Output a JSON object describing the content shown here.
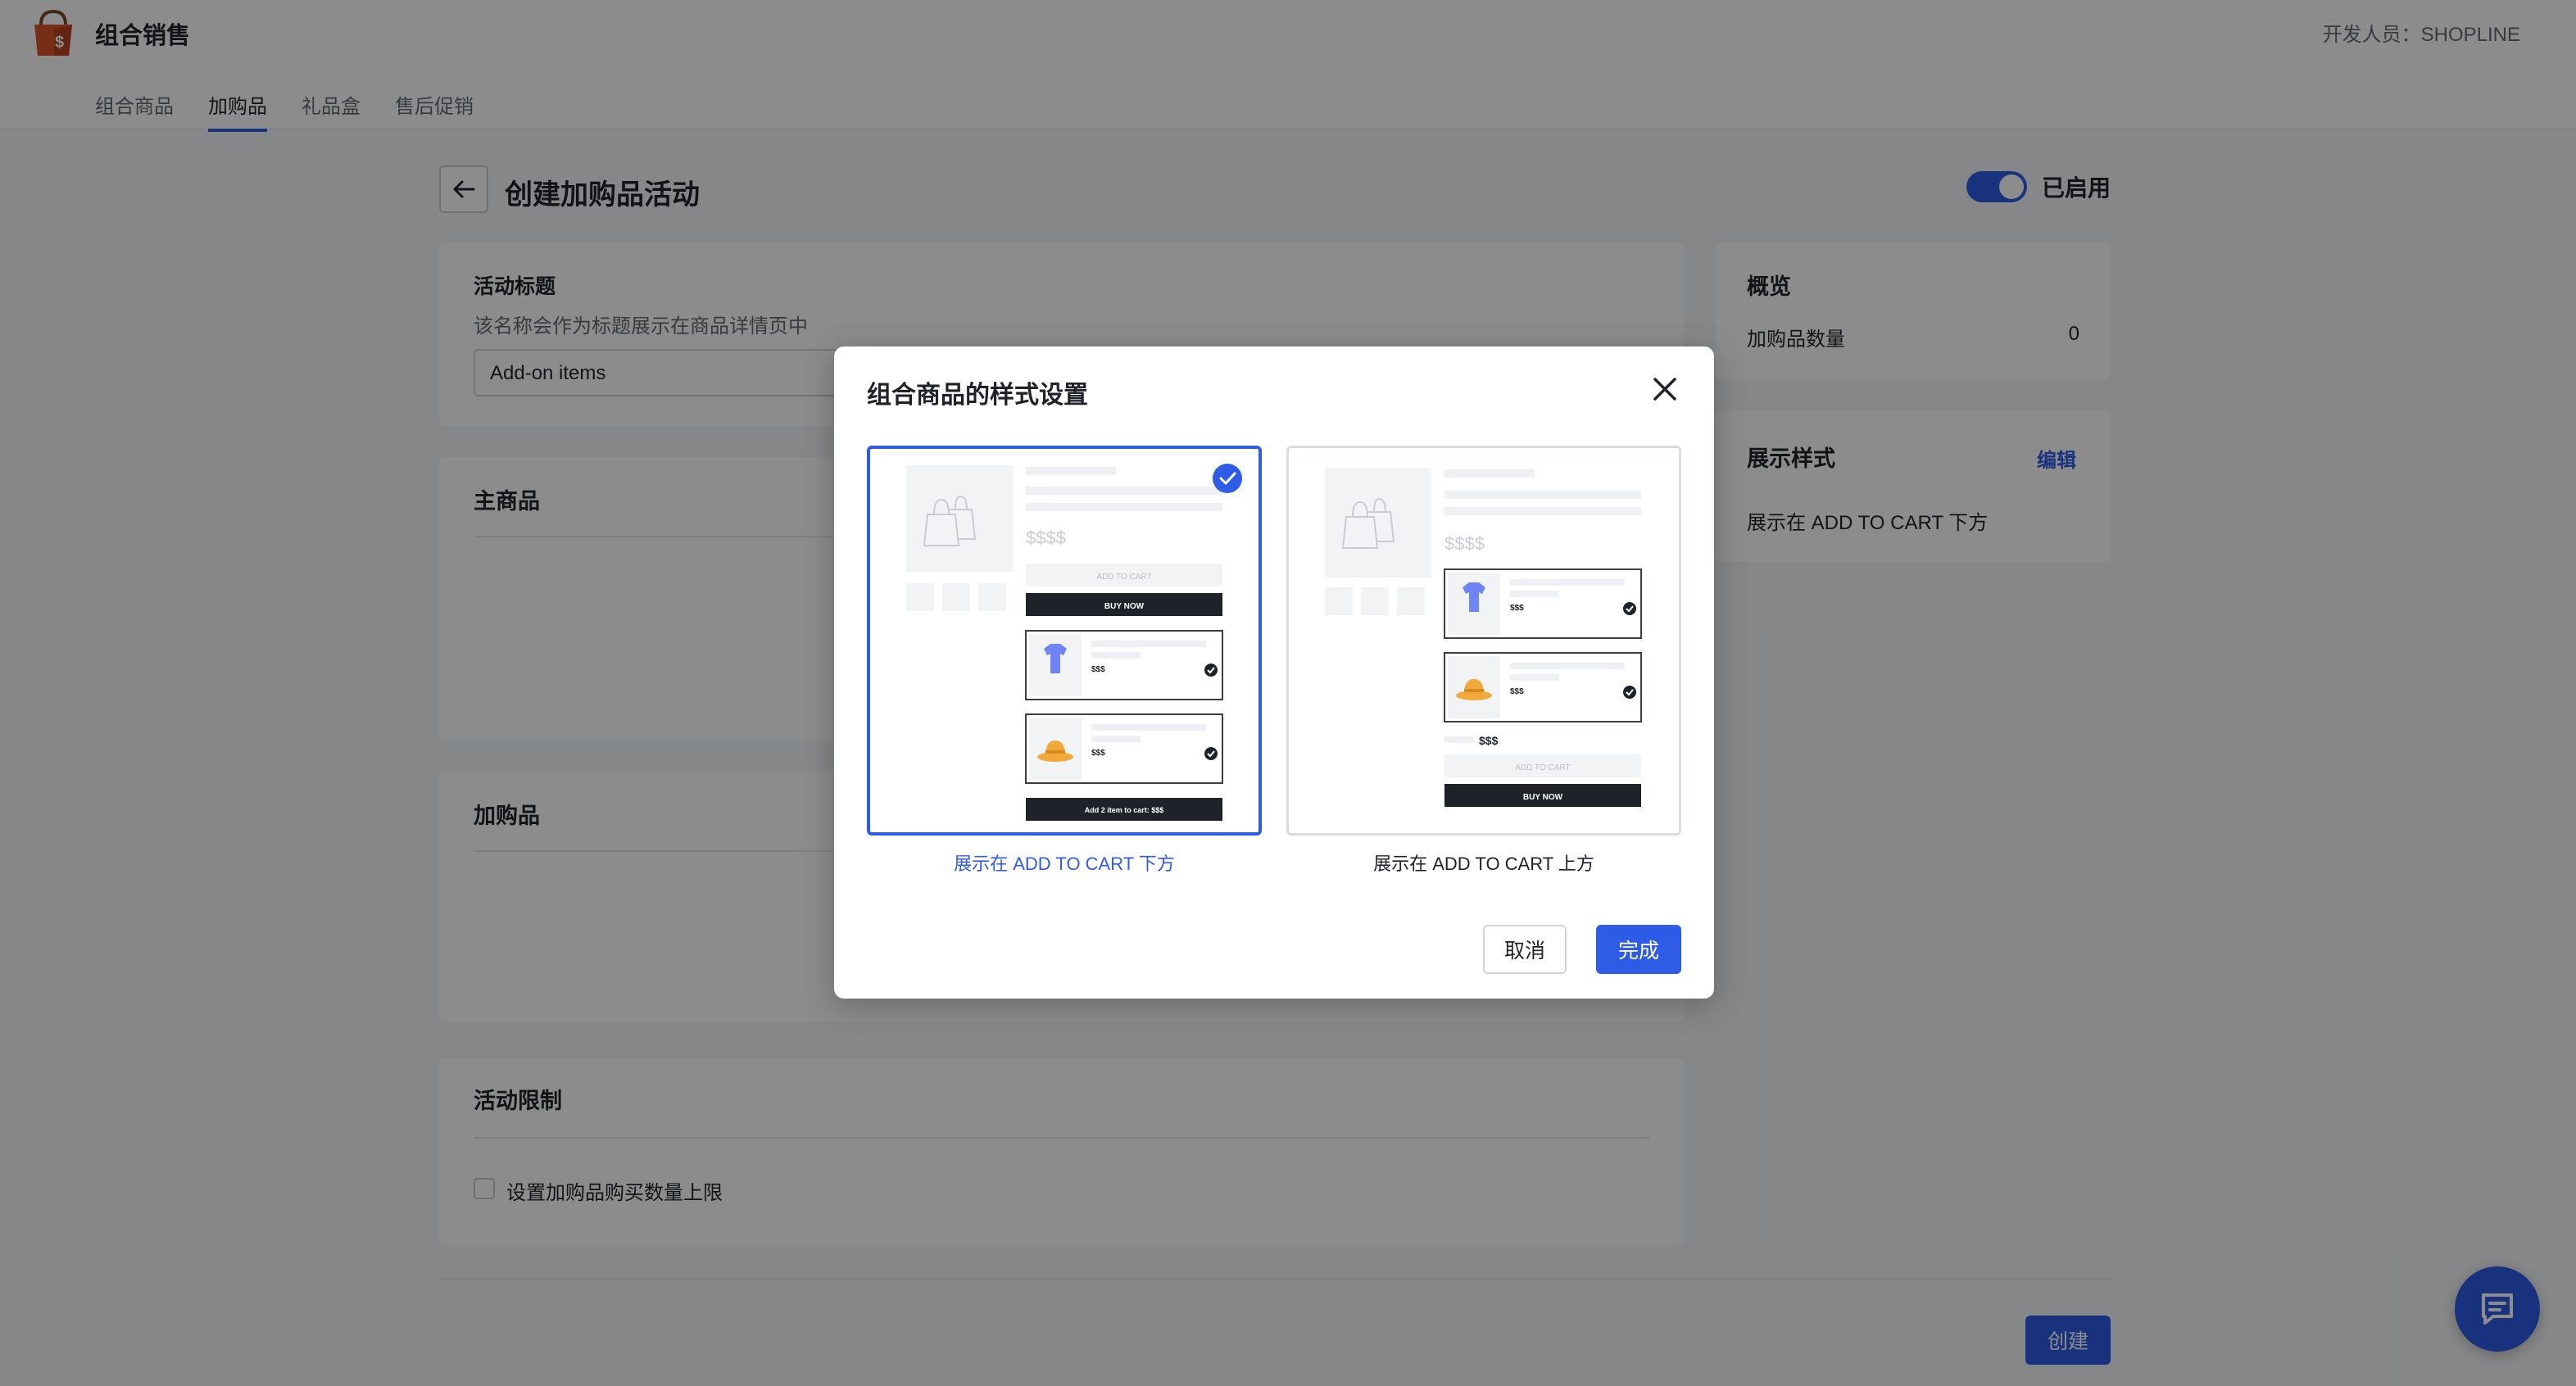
{
  "app": {
    "title": "组合销售",
    "developer": "开发人员：SHOPLINE"
  },
  "tabs": [
    "组合商品",
    "加购品",
    "礼品盒",
    "售后促销"
  ],
  "page": {
    "title": "创建加购品活动",
    "status_label": "已启用"
  },
  "activity_title": {
    "heading": "活动标题",
    "description": "该名称会作为标题展示在商品详情页中",
    "value": "Add-on items"
  },
  "main_product": {
    "heading": "主商品"
  },
  "addon_product": {
    "heading": "加购品"
  },
  "limit": {
    "heading": "活动限制",
    "checkbox_label": "设置加购品购买数量上限",
    "checked": false
  },
  "overview": {
    "heading": "概览",
    "count_label": "加购品数量",
    "count_value": "0"
  },
  "display_style": {
    "heading": "展示样式",
    "edit_label": "编辑",
    "current": "展示在 ADD TO CART 下方"
  },
  "create_button": "创建",
  "modal": {
    "title": "组合商品的样式设置",
    "options": [
      {
        "label": "展示在 ADD TO CART 下方",
        "selected": true,
        "preview": {
          "price": "$$$$",
          "add_to_cart": "ADD TO CART",
          "buy_now": "BUY NOW",
          "item_price": "$$$",
          "summary": "Add 2 item to cart: $$$"
        }
      },
      {
        "label": "展示在 ADD TO CART 上方",
        "selected": false,
        "preview": {
          "price": "$$$$",
          "add_to_cart": "ADD TO CART",
          "buy_now": "BUY NOW",
          "item_price": "$$$",
          "total": "$$$"
        }
      }
    ],
    "cancel_label": "取消",
    "done_label": "完成"
  },
  "colors": {
    "accent": "#2f5ce6",
    "shirt": "#6f84f5",
    "hat": "#f2a93b"
  }
}
